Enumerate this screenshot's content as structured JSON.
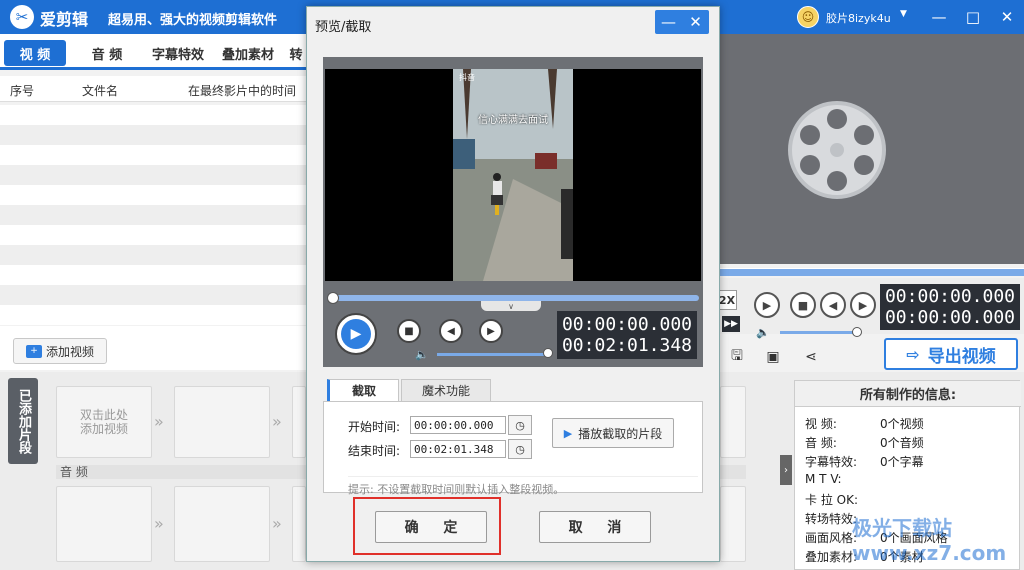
{
  "app": {
    "name": "爱剪辑",
    "slogan": "超易用、强大的视频剪辑软件",
    "user": "胶片8izyk4u",
    "window_controls": [
      "—",
      "□",
      "✕"
    ]
  },
  "tabs": [
    "视 频",
    "音 频",
    "字幕特效",
    "叠加素材",
    "转"
  ],
  "table": {
    "columns": [
      "序号",
      "文件名",
      "在最终影片中的时间"
    ]
  },
  "add_video_label": "添加视频",
  "timeline": {
    "added_label": "已添加片段",
    "slot_hint": "双击此处\n添加视频",
    "audio_label": "音 频"
  },
  "right_player": {
    "speed": "2X",
    "current_time": "00:00:00.000",
    "total_time": "00:00:00.000"
  },
  "export_label": "导出视频",
  "info": {
    "title": "所有制作的信息:",
    "rows": [
      {
        "label": "视    频:",
        "value": "0个视频"
      },
      {
        "label": "音    频:",
        "value": "0个音频"
      },
      {
        "label": "字幕特效:",
        "value": "0个字幕"
      },
      {
        "label": "M  T  V:",
        "value": ""
      },
      {
        "label": "卡 拉 OK:",
        "value": ""
      },
      {
        "label": "转场特效:",
        "value": ""
      },
      {
        "label": "画面风格:",
        "value": "0个画面风格"
      },
      {
        "label": "叠加素材:",
        "value": "0个素材"
      }
    ]
  },
  "watermark": "极光下载站 www.xz7.com",
  "dialog": {
    "title": "预览/截取",
    "video_caption": "信心满满去面试",
    "video_brand": "抖音",
    "current_time": "00:00:00.000",
    "total_time": "00:02:01.348",
    "tabs": [
      "截取",
      "魔术功能"
    ],
    "start_label": "开始时间:",
    "start_value": "00:00:00.000",
    "end_label": "结束时间:",
    "end_value": "00:02:01.348",
    "play_clip_label": "播放截取的片段",
    "hint": "提示: 不设置截取时间则默认插入整段视频。",
    "ok_label": "确 定",
    "cancel_label": "取 消"
  },
  "colors": {
    "brand_blue": "#1e6fd3",
    "accent_blue": "#2f7fe0",
    "highlight_red": "#e0302a",
    "player_dark": "#2b2f36"
  }
}
